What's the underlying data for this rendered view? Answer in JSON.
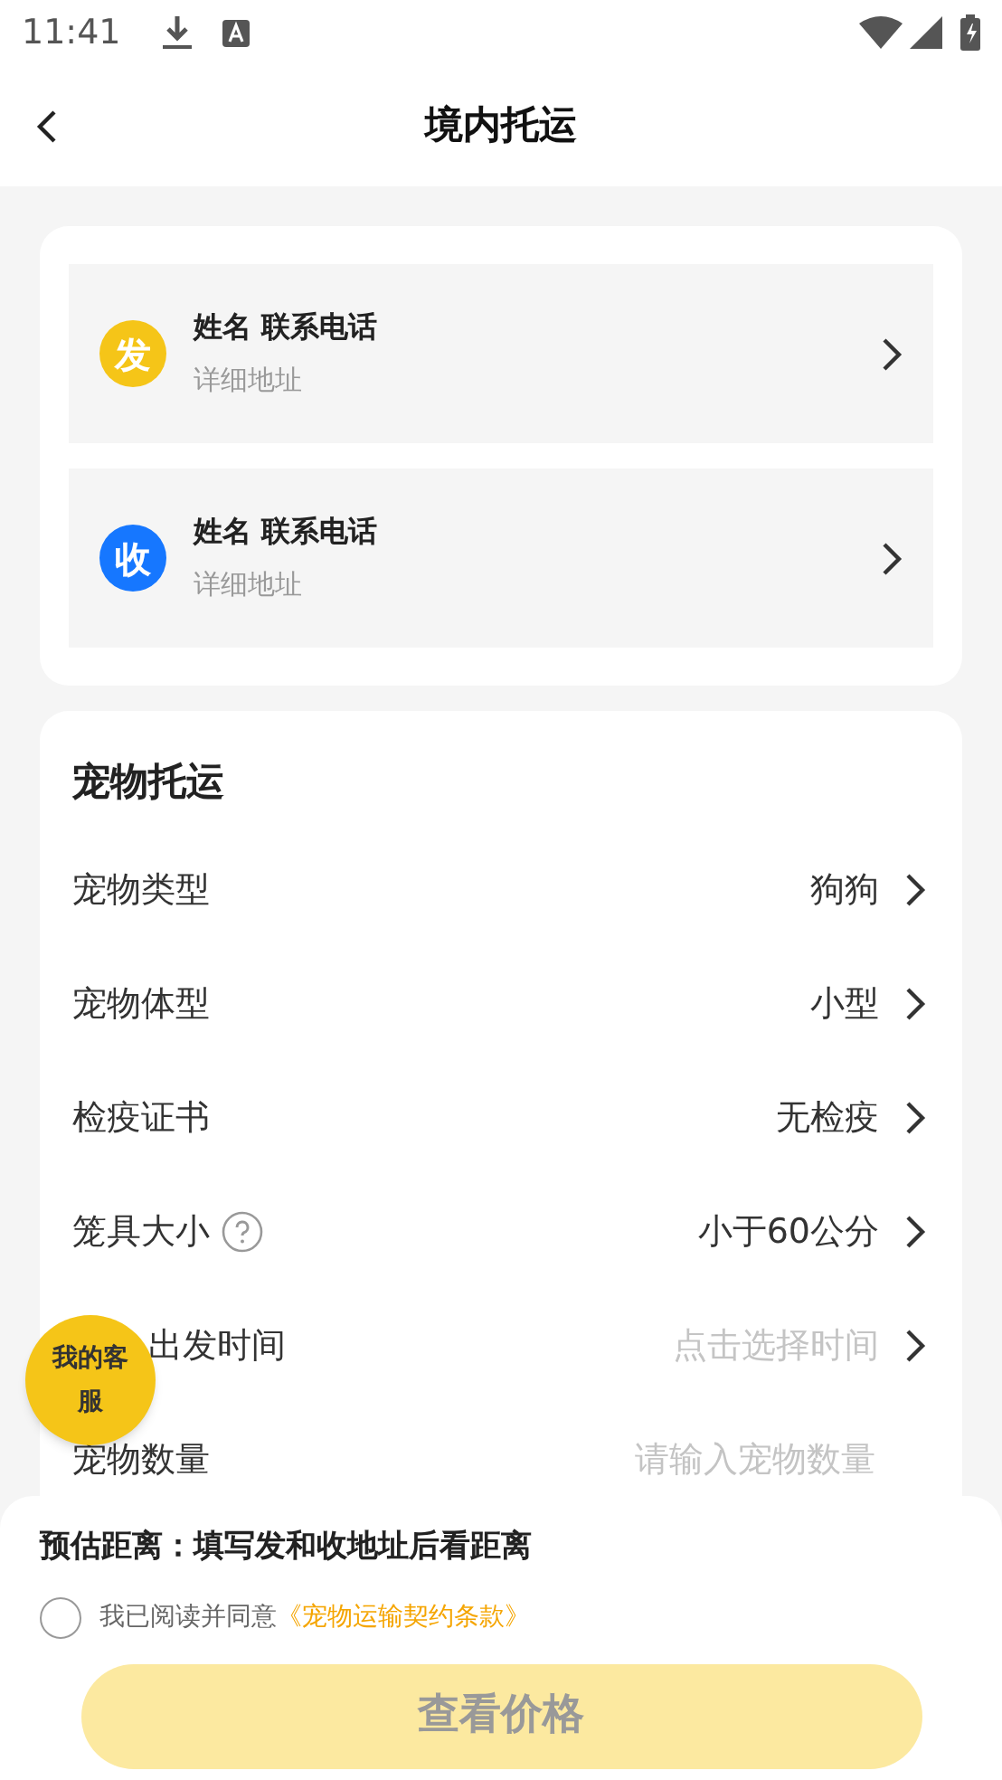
{
  "status_bar": {
    "time": "11:41"
  },
  "header": {
    "title": "境内托运"
  },
  "contacts": [
    {
      "badge": "发",
      "color": "#f5c518",
      "name": "姓名 联系电话",
      "address": "详细地址"
    },
    {
      "badge": "收",
      "color": "#1677ff",
      "name": "姓名 联系电话",
      "address": "详细地址"
    }
  ],
  "pet_section": {
    "title": "宠物托运",
    "rows": [
      {
        "kind": "select",
        "label": "宠物类型",
        "value": "狗狗",
        "help": false
      },
      {
        "kind": "select",
        "label": "宠物体型",
        "value": "小型",
        "help": false
      },
      {
        "kind": "select",
        "label": "检疫证书",
        "value": "无检疫",
        "help": false
      },
      {
        "kind": "select",
        "label": "笼具大小",
        "value": "小于60公分",
        "help": true
      },
      {
        "kind": "select",
        "label": "出发时间",
        "placeholder": "点击选择时间",
        "help": false,
        "partly_covered": true
      },
      {
        "kind": "input",
        "label": "宠物数量",
        "placeholder": "请输入宠物数量",
        "help": false
      }
    ]
  },
  "service_button": {
    "label": "我的客服"
  },
  "bottom": {
    "distance": "预估距离：填写发和收地址后看距离",
    "agree_text": "我已阅读并同意",
    "agree_link": "《宠物运输契约条款》",
    "checked": false,
    "button": {
      "label": "查看价格",
      "disabled": true
    }
  }
}
